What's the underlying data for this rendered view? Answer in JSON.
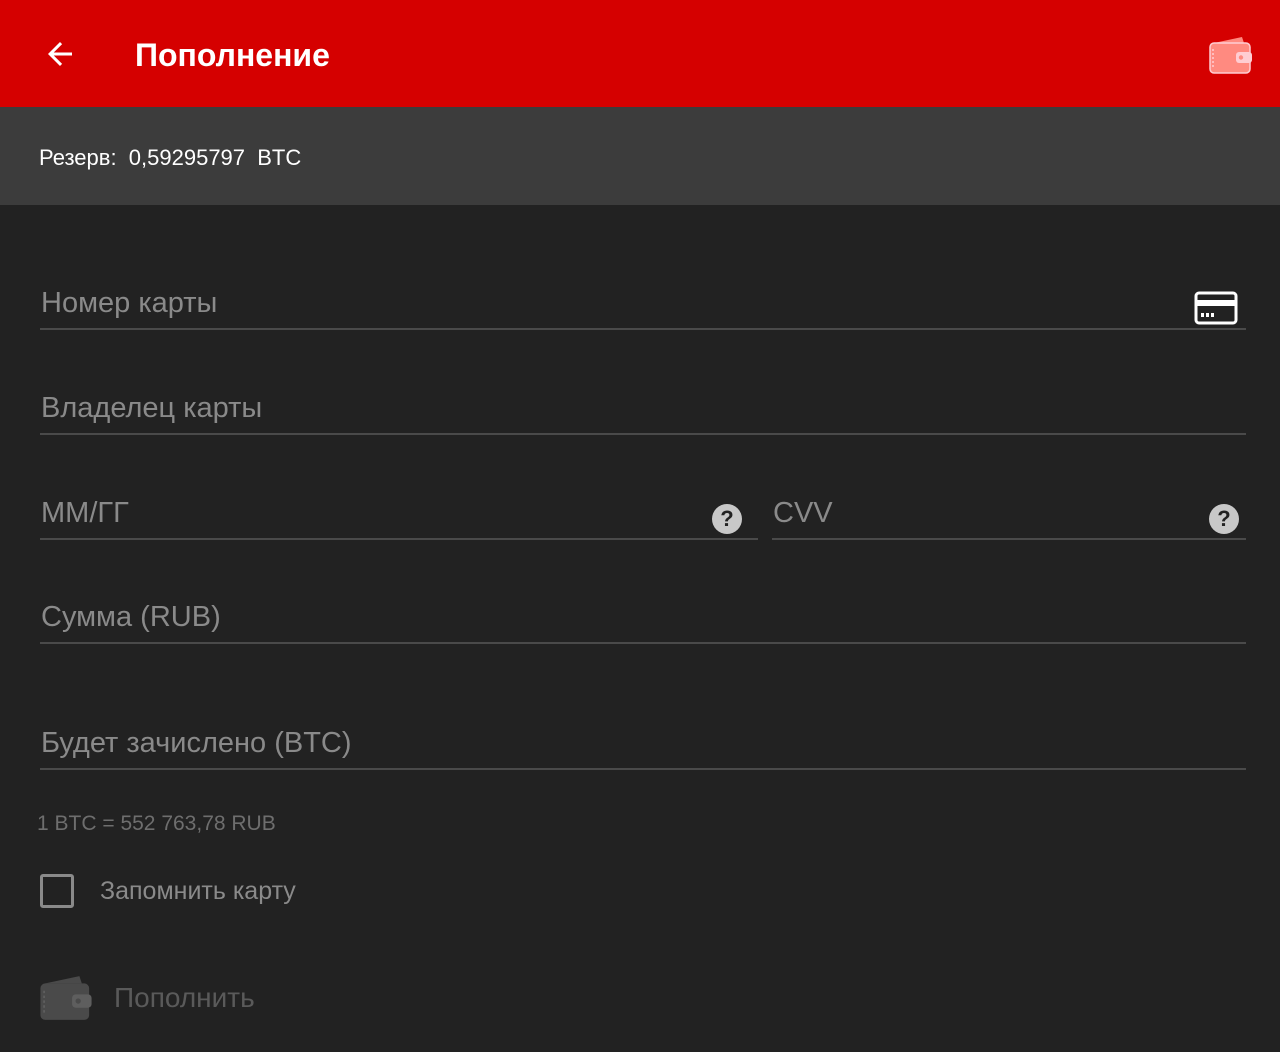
{
  "appbar": {
    "title": "Пополнение",
    "back_icon": "arrow-left-icon",
    "action_icon": "wallet-icon",
    "color": "#d50000"
  },
  "reserve": {
    "text": "Резерв:  0,59295797  BTC"
  },
  "form": {
    "card_number": {
      "placeholder": "Номер карты",
      "value": "",
      "icon": "credit-card-icon"
    },
    "card_holder": {
      "placeholder": "Владелец карты",
      "value": ""
    },
    "expiry": {
      "placeholder": "ММ/ГГ",
      "value": "",
      "help": "?"
    },
    "cvv": {
      "placeholder": "CVV",
      "value": "",
      "help": "?"
    },
    "amount": {
      "placeholder": "Сумма (RUB)",
      "value": ""
    },
    "credited": {
      "placeholder": "Будет зачислено (BTC)",
      "value": ""
    }
  },
  "rate": {
    "text": "1 BTC = 552 763,78 RUB"
  },
  "remember": {
    "label": "Запомнить карту",
    "checked": false
  },
  "submit": {
    "label": "Пополнить",
    "icon": "wallet-icon",
    "enabled": false
  }
}
